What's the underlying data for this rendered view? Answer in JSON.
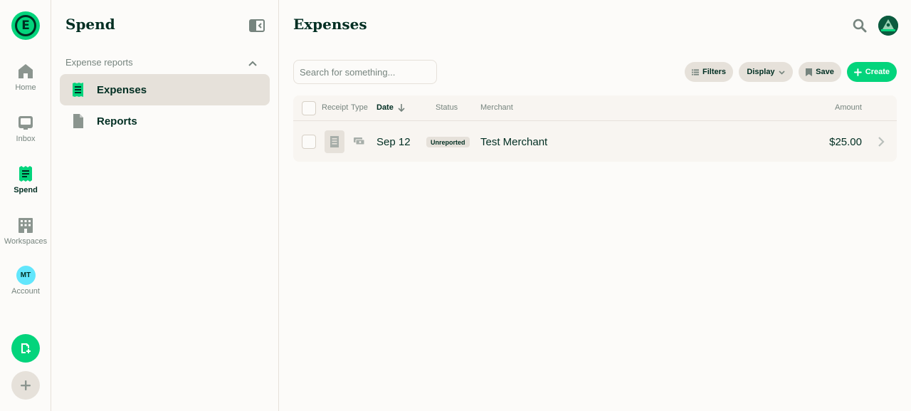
{
  "nav": {
    "logo_letter": "E",
    "items": [
      {
        "label": "Home",
        "icon": "home-icon"
      },
      {
        "label": "Inbox",
        "icon": "inbox-icon"
      },
      {
        "label": "Spend",
        "icon": "receipt-icon"
      },
      {
        "label": "Workspaces",
        "icon": "building-icon"
      },
      {
        "label": "Account",
        "icon": "avatar",
        "initials": "MT"
      }
    ],
    "active": "Spend",
    "fab_primary_icon": "new-expense-icon",
    "fab_secondary_icon": "plus-icon"
  },
  "sidebar": {
    "title": "Spend",
    "section_label": "Expense reports",
    "items": [
      {
        "label": "Expenses",
        "icon": "receipt-icon",
        "active": true
      },
      {
        "label": "Reports",
        "icon": "document-icon",
        "active": false
      }
    ]
  },
  "main": {
    "title": "Expenses",
    "search": {
      "placeholder": "Search for something...",
      "value": ""
    },
    "actions": {
      "filters": "Filters",
      "display": "Display",
      "save": "Save",
      "create": "Create"
    },
    "table": {
      "columns": {
        "receipt": "Receipt",
        "type": "Type",
        "date": "Date",
        "status": "Status",
        "merchant": "Merchant",
        "amount": "Amount"
      },
      "sort": {
        "column": "date",
        "direction": "descending"
      },
      "rows": [
        {
          "date": "Sep 12",
          "status": "Unreported",
          "merchant": "Test Merchant",
          "amount": "$25.00"
        }
      ]
    }
  },
  "colors": {
    "accent": "#03d47c",
    "text": "#002e22",
    "muted": "#76847e",
    "border": "#e6e1da",
    "background": "#fcfbf9"
  }
}
